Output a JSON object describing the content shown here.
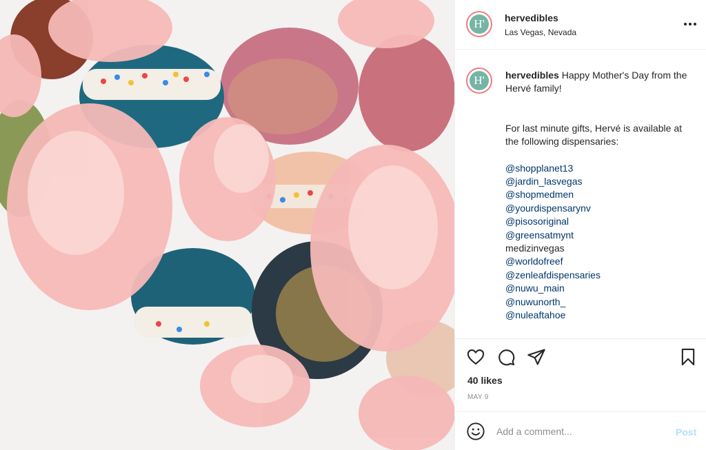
{
  "post": {
    "username": "hervedibles",
    "location": "Las Vegas, Nevada",
    "avatar_letter": "H'",
    "caption": {
      "username": "hervedibles",
      "text": "Happy Mother's Day from the Hervé family!",
      "body": "For last minute gifts, Hervé is available at the following dispensaries:",
      "lines": [
        {
          "text": "@shopplanet13",
          "mention": true
        },
        {
          "text": "@jardin_lasvegas",
          "mention": true
        },
        {
          "text": "@shopmedmen",
          "mention": true
        },
        {
          "text": "@yourdispensarynv",
          "mention": true
        },
        {
          "text": "@pisosoriginal",
          "mention": true
        },
        {
          "text": "@greensatmynt",
          "mention": true
        },
        {
          "text": "medizinvegas",
          "mention": false
        },
        {
          "text": "@worldofreef",
          "mention": true
        },
        {
          "text": "@zenleafdispensaries",
          "mention": true
        },
        {
          "text": "@nuwu_main",
          "mention": true
        },
        {
          "text": "@nuwunorth_",
          "mention": true
        },
        {
          "text": "@nuleaftahoe",
          "mention": true
        }
      ]
    },
    "likes": "40 likes",
    "date": "MAY 9"
  },
  "comment": {
    "placeholder": "Add a comment...",
    "post_label": "Post"
  },
  "icons": {
    "more": "more-options-icon",
    "like": "heart-icon",
    "comment": "comment-icon",
    "share": "paper-plane-icon",
    "save": "bookmark-icon",
    "emoji": "smiley-icon"
  },
  "colors": {
    "mention": "#00376b",
    "avatar_ring": "#f07b84",
    "avatar_fill": "#76b5a5",
    "post_button": "#b2dffc"
  }
}
